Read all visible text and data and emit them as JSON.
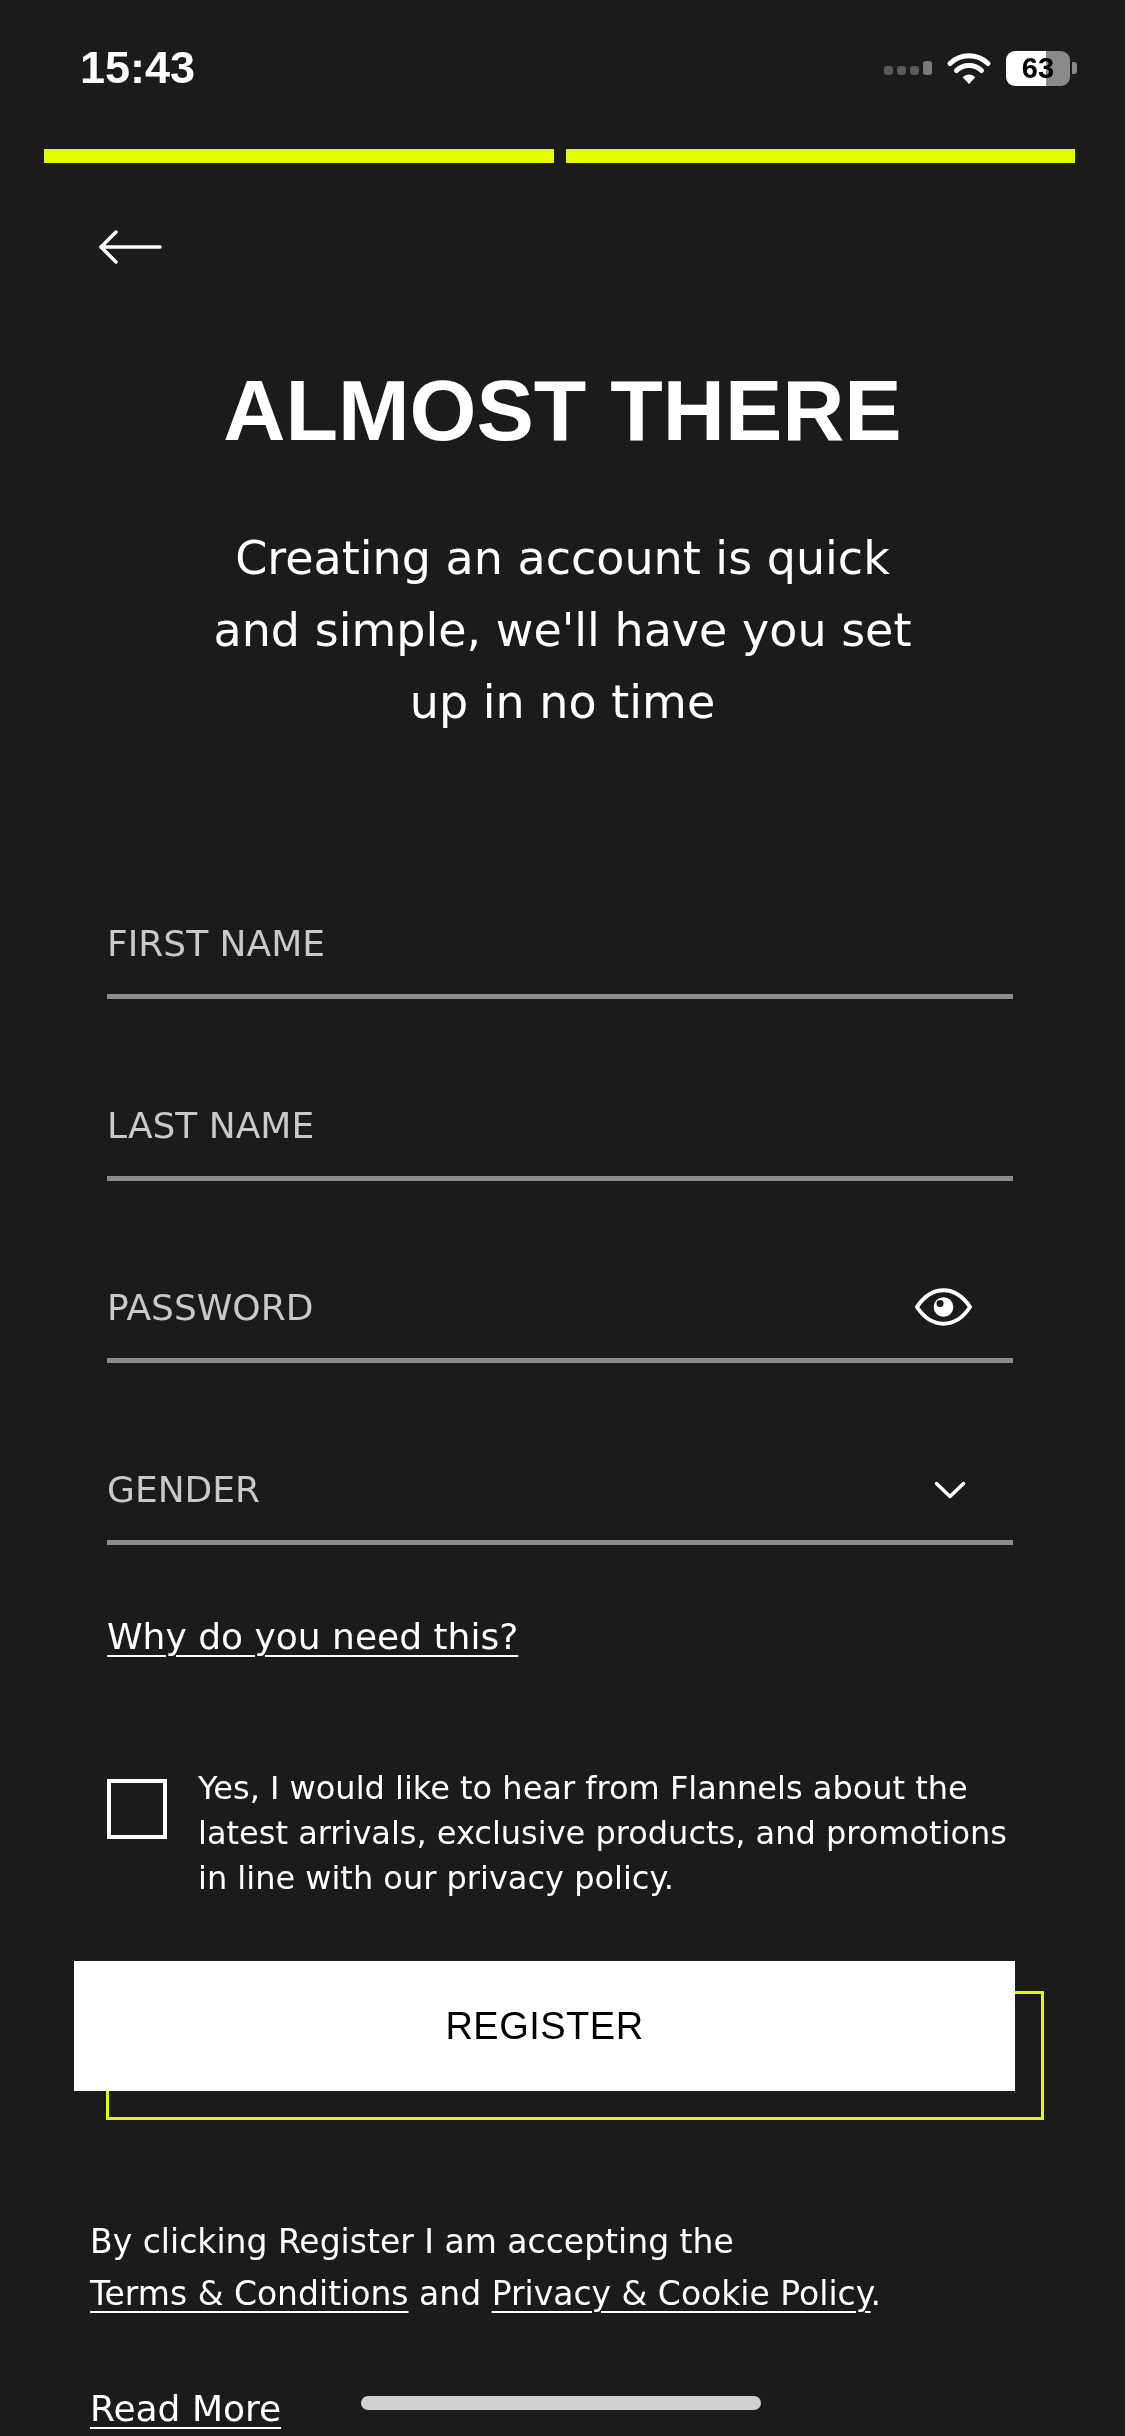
{
  "status_bar": {
    "time": "15:43",
    "battery": "63"
  },
  "progress_steps": [
    {
      "completed": true
    },
    {
      "completed": true
    }
  ],
  "header": {
    "title": "ALMOST THERE",
    "subtitle": "Creating an account is quick and simple, we'll have you set up in no time"
  },
  "fields": [
    {
      "kind": "text",
      "placeholder": "FIRST NAME"
    },
    {
      "kind": "text",
      "placeholder": "LAST NAME"
    },
    {
      "kind": "password",
      "placeholder": "PASSWORD"
    },
    {
      "kind": "select",
      "placeholder": "GENDER"
    }
  ],
  "help_link": "Why do you need this?",
  "consent": {
    "checked": false,
    "text": "Yes, I would like to hear from Flannels about the latest arrivals, exclusive products, and promotions in line with our privacy policy."
  },
  "register_button": "REGISTER",
  "legal": [
    {
      "kind": "text",
      "text": "By clicking Register I am accepting the "
    },
    {
      "kind": "link",
      "text": "Terms & Conditions"
    },
    {
      "kind": "text",
      "text": " and "
    },
    {
      "kind": "link",
      "text": "Privacy & Cookie Policy"
    },
    {
      "kind": "text",
      "text": "."
    }
  ],
  "read_more": "Read More"
}
